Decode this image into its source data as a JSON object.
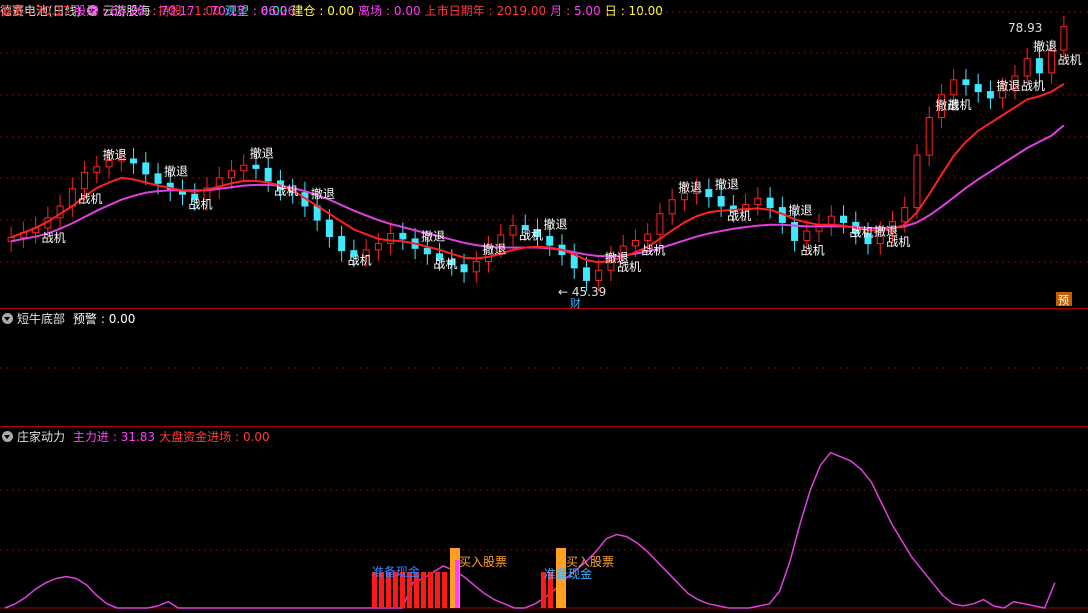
{
  "panel1": {
    "title": "德赛电池(日线)",
    "indicator": "云游股海",
    "fields": [
      {
        "label": "持股",
        "value": "1.00",
        "color": "#ff3b3b"
      },
      {
        "label": "观望",
        "value": "0.00",
        "color": "#40e0ff"
      },
      {
        "label": "建仓",
        "value": "0.00",
        "color": "#ffff40"
      },
      {
        "label": "离场",
        "value": "0.00",
        "color": "#ff40ff"
      },
      {
        "label": "上市日期年",
        "value": "2019.00",
        "color": "#ff3b3b"
      },
      {
        "label": "月",
        "value": "5.00",
        "color": "#ff40ff"
      },
      {
        "label": "日",
        "value": "10.00",
        "color": "#ffff40"
      }
    ],
    "right_fields": [
      {
        "label": "云游",
        "value": "70.17",
        "color": "#ff3b3b"
      },
      {
        "label": "股海",
        "value": "66.26",
        "color": "#ff40ff"
      },
      {
        "label": "",
        "value": "70.17",
        "color": "#ff40ff"
      },
      {
        "label": "",
        "value": "70.17",
        "color": "#ff40ff"
      },
      {
        "label": "",
        "value": "66.26",
        "color": "#ff40ff"
      }
    ],
    "high_label": "78.93",
    "low_label": "45.39",
    "pre_badge": "预",
    "cai_badge": "财",
    "exit_text": "撤退",
    "chance_text": "战机"
  },
  "panel2": {
    "indicator": "短牛底部",
    "fields": [
      {
        "label": "预警",
        "value": "0.00",
        "color": "#ffffff"
      }
    ]
  },
  "panel3": {
    "indicator": "庄家动力",
    "fields": [
      {
        "label": "主力进",
        "value": "31.83",
        "color": "#ff40ff"
      },
      {
        "label": "大盘资金进场",
        "value": "0.00",
        "color": "#ff3b3b"
      }
    ],
    "prepare_cash": "准备现金",
    "buy_stock": "买入股票"
  },
  "chart_data": {
    "type": "candlestick",
    "price_series": [
      52.0,
      52.6,
      53.2,
      54.5,
      56.0,
      58.2,
      60.3,
      61.0,
      61.8,
      62.0,
      61.5,
      60.1,
      58.9,
      58.0,
      57.5,
      56.8,
      58.3,
      59.6,
      60.5,
      61.2,
      60.8,
      59.2,
      58.1,
      57.7,
      56.0,
      54.2,
      52.1,
      50.3,
      49.6,
      50.4,
      51.2,
      52.5,
      51.8,
      50.6,
      49.9,
      49.1,
      48.5,
      47.6,
      48.9,
      50.8,
      52.3,
      53.5,
      53.0,
      52.1,
      51.0,
      49.8,
      48.1,
      46.5,
      47.8,
      49.5,
      50.9,
      51.6,
      52.4,
      55.0,
      56.8,
      57.6,
      58.1,
      57.2,
      56.0,
      55.3,
      56.2,
      57.0,
      55.8,
      53.9,
      51.6,
      52.8,
      53.6,
      54.7,
      53.9,
      52.5,
      51.2,
      52.7,
      54.0,
      55.8,
      62.5,
      67.3,
      70.2,
      72.1,
      71.5,
      70.6,
      69.8,
      71.0,
      72.6,
      74.8,
      73.0,
      75.9,
      78.9
    ],
    "ma_red": [
      52.0,
      52.6,
      53.2,
      54.0,
      55.0,
      56.0,
      57.2,
      58.3,
      59.0,
      59.6,
      59.4,
      59.0,
      58.6,
      58.3,
      58.0,
      57.8,
      58.1,
      58.5,
      58.9,
      59.2,
      59.2,
      59.0,
      58.6,
      58.0,
      57.0,
      56.0,
      55.0,
      54.0,
      53.0,
      52.4,
      51.8,
      51.6,
      51.5,
      51.2,
      50.8,
      50.4,
      49.9,
      49.4,
      49.3,
      49.5,
      49.9,
      50.4,
      50.7,
      50.8,
      50.7,
      50.4,
      49.8,
      49.1,
      48.8,
      49.0,
      49.5,
      50.1,
      50.8,
      51.8,
      52.9,
      53.9,
      54.7,
      55.2,
      55.4,
      55.5,
      55.6,
      55.7,
      55.5,
      55.0,
      54.3,
      53.9,
      53.6,
      53.6,
      53.5,
      53.2,
      52.9,
      52.9,
      53.1,
      53.6,
      55.2,
      57.5,
      60.0,
      62.4,
      64.2,
      65.6,
      66.6,
      67.6,
      68.6,
      69.6,
      70.0,
      70.6,
      71.6
    ],
    "ma_magenta": [
      51.5,
      51.8,
      52.1,
      52.5,
      53.1,
      53.8,
      54.6,
      55.4,
      56.1,
      56.8,
      57.3,
      57.7,
      57.9,
      58.0,
      58.0,
      58.0,
      58.0,
      58.2,
      58.4,
      58.6,
      58.7,
      58.7,
      58.6,
      58.3,
      57.9,
      57.4,
      56.8,
      56.1,
      55.4,
      54.8,
      54.2,
      53.7,
      53.3,
      52.9,
      52.5,
      52.1,
      51.7,
      51.3,
      51.0,
      50.8,
      50.7,
      50.7,
      50.7,
      50.7,
      50.6,
      50.4,
      50.1,
      49.8,
      49.6,
      49.6,
      49.7,
      49.9,
      50.2,
      50.6,
      51.1,
      51.6,
      52.1,
      52.5,
      52.8,
      53.1,
      53.3,
      53.5,
      53.6,
      53.6,
      53.5,
      53.4,
      53.4,
      53.4,
      53.4,
      53.3,
      53.2,
      53.2,
      53.2,
      53.4,
      53.9,
      54.8,
      55.9,
      57.1,
      58.3,
      59.4,
      60.4,
      61.4,
      62.4,
      63.4,
      64.2,
      65.0,
      66.3
    ],
    "y_range": [
      44,
      80
    ],
    "dynamics_line": [
      0,
      2,
      5,
      9,
      12,
      14,
      15,
      14,
      11,
      6,
      2,
      0,
      0,
      0,
      0,
      1,
      3,
      0,
      0,
      0,
      0,
      0,
      0,
      0,
      0,
      0,
      0,
      0,
      0,
      0,
      0,
      0,
      0,
      0,
      0,
      0,
      0,
      0,
      0,
      0,
      12,
      14,
      17,
      20,
      18,
      15,
      11,
      7,
      4,
      2,
      0,
      0,
      2,
      5,
      9,
      14,
      18,
      22,
      27,
      33,
      35,
      34,
      31,
      27,
      22,
      17,
      12,
      7,
      4,
      2,
      1,
      0,
      0,
      0,
      1,
      2,
      8,
      22,
      40,
      56,
      68,
      74,
      72,
      70,
      66,
      60,
      50,
      40,
      32,
      24,
      18,
      12,
      6,
      2,
      1,
      2,
      4,
      1,
      0,
      3,
      2,
      1,
      0,
      12
    ],
    "y_range_dynamics": [
      0,
      80
    ]
  }
}
